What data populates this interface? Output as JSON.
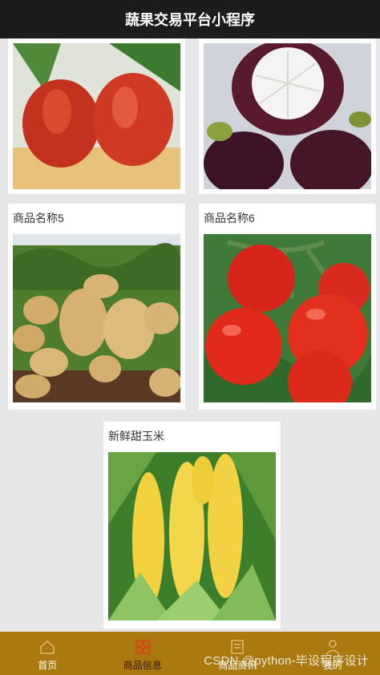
{
  "app": {
    "title": "蔬果交易平台小程序"
  },
  "products": [
    {
      "name": "",
      "image": "rose-apple-photo"
    },
    {
      "name": "",
      "image": "mangosteen-photo"
    },
    {
      "name": "商品名称5",
      "image": "potato-photo"
    },
    {
      "name": "商品名称6",
      "image": "tomato-photo"
    },
    {
      "name": "新鲜甜玉米",
      "image": "sweet-corn-photo"
    }
  ],
  "tabbar": {
    "items": [
      {
        "label": "首页",
        "icon": "home-icon"
      },
      {
        "label": "商品信息",
        "icon": "product-grid-icon",
        "active": true
      },
      {
        "label": "商品资讯",
        "icon": "news-icon"
      },
      {
        "label": "我的",
        "icon": "user-icon"
      }
    ]
  },
  "watermark": "CSDN @python-毕设程序设计",
  "colors": {
    "titlebar": "#1c1c1e",
    "tabbar": "#a9780f",
    "active_icon": "#e0411b",
    "background": "#e6e6e8"
  }
}
